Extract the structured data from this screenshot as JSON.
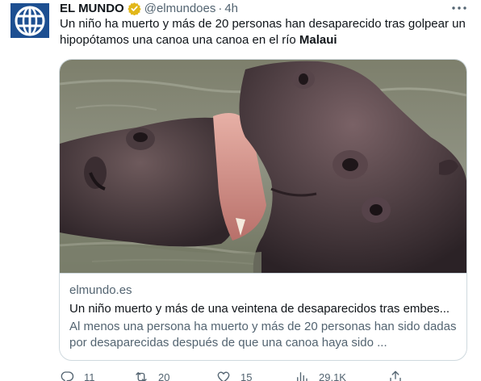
{
  "author": {
    "name": "EL MUNDO",
    "handle": "@elmundoes",
    "separator": "·",
    "time": "4h",
    "verified_badge_color": "#e2b719",
    "avatar_color": "#1d4f91"
  },
  "tweet": {
    "text_before": "Un niño ha muerto y más de 20 personas han desaparecido tras golpear un hipopótamos una canoa una canoa en el río ",
    "text_bold": "Malaui"
  },
  "card": {
    "image_icon": "hippos-photo",
    "domain": "elmundo.es",
    "title": "Un niño muerto y más de una veintena de desaparecidos tras embes...",
    "description": "Al menos una persona ha muerto y más de 20 personas han sido dadas por desaparecidas después de que una canoa haya sido ..."
  },
  "actions": {
    "reply_count": "11",
    "retweet_count": "20",
    "like_count": "15",
    "views_count": "29,1K"
  },
  "icons": {
    "more": "more-dots-icon",
    "reply": "reply-icon",
    "retweet": "retweet-icon",
    "like": "heart-icon",
    "views": "analytics-icon",
    "share": "share-icon"
  }
}
